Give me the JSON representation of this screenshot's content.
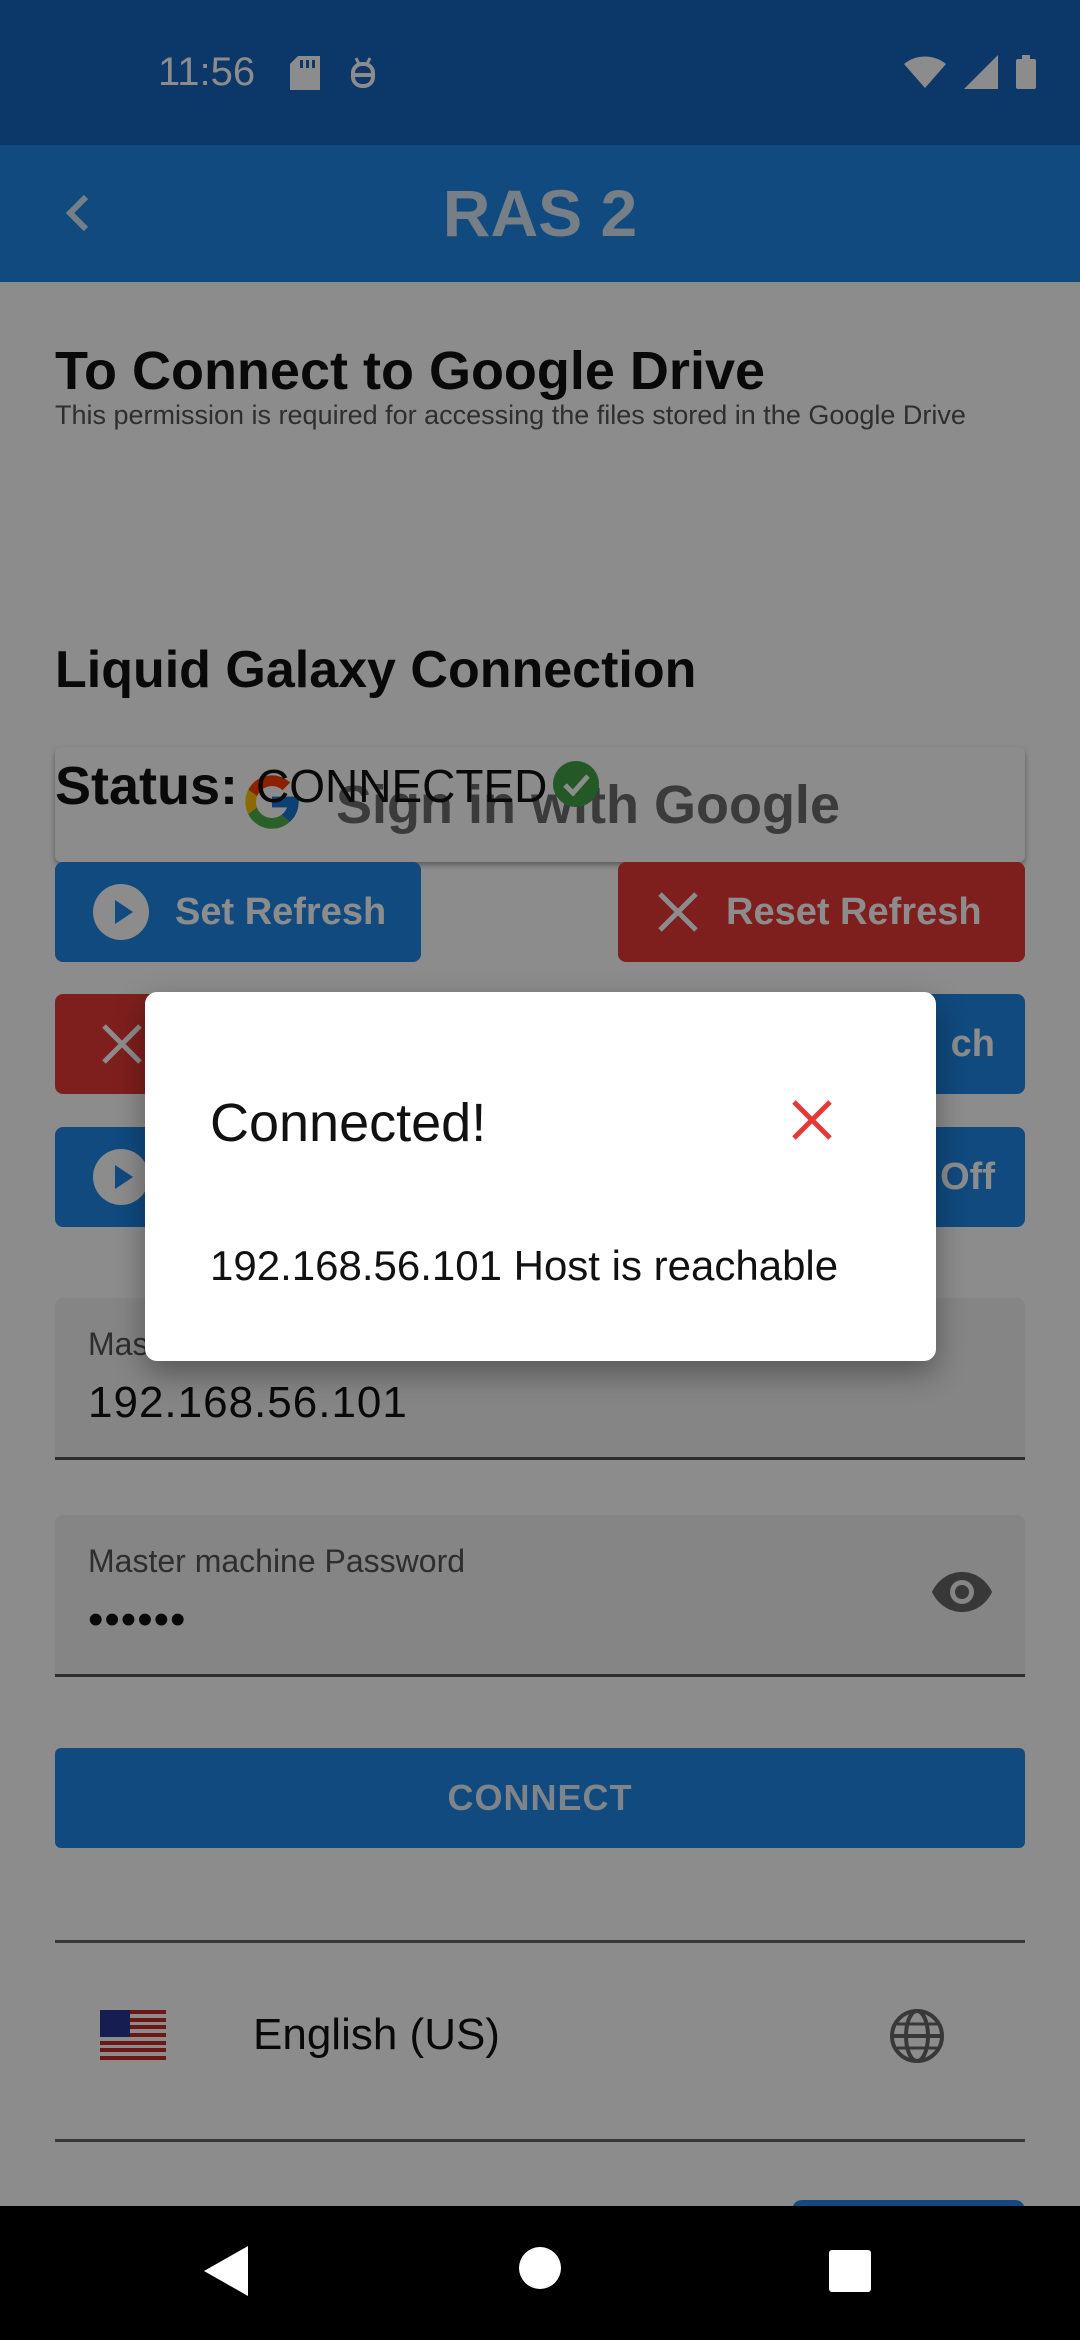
{
  "status_bar": {
    "time": "11:56"
  },
  "app_bar": {
    "title": "RAS 2"
  },
  "google_drive": {
    "heading": "To Connect to Google Drive",
    "description": "This permission is required for accessing the files stored in the Google Drive",
    "sign_in_label": "Sign in with Google"
  },
  "lg_connection": {
    "heading": "Liquid Galaxy Connection",
    "status_label": "Status:",
    "status_value": "CONNECTED"
  },
  "buttons": {
    "set_refresh": "Set Refresh",
    "reset_refresh": "Reset Refresh",
    "row2_right_partial": "ch",
    "row3_right_partial": "Off"
  },
  "fields": {
    "master_ip": {
      "label_partial": "Mas",
      "value": "192.168.56.101"
    },
    "master_password": {
      "label": "Master machine Password",
      "value": "••••••"
    }
  },
  "connect_label": "CONNECT",
  "language": {
    "name": "English (US)",
    "flag": "us-flag-icon"
  },
  "dialog": {
    "title": "Connected!",
    "message": "192.168.56.101 Host is reachable"
  },
  "colors": {
    "primary": "#1E88E5",
    "danger": "#E53935",
    "success": "#43A047"
  }
}
